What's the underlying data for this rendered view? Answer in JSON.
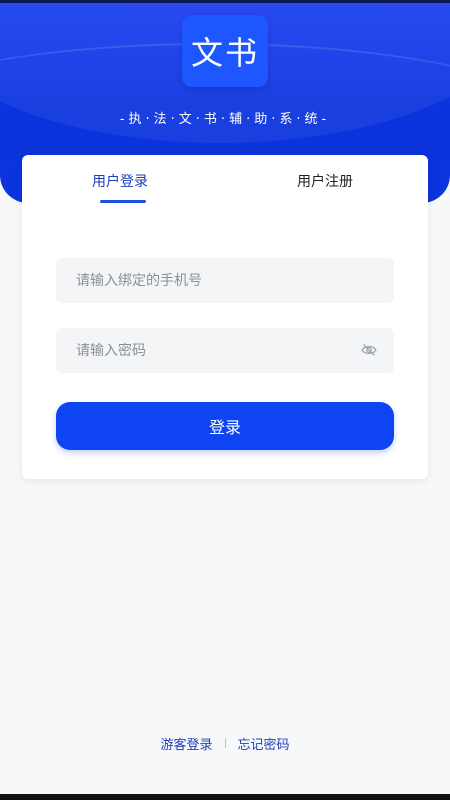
{
  "app": {
    "logo_text": "文书",
    "subtitle": "-执·法·文·书·辅·助·系·统-"
  },
  "tabs": {
    "login": "用户登录",
    "register": "用户注册"
  },
  "form": {
    "phone_placeholder": "请输入绑定的手机号",
    "password_placeholder": "请输入密码",
    "login_button": "登录"
  },
  "footer": {
    "guest_login": "游客登录",
    "forgot_password": "忘记密码"
  },
  "colors": {
    "primary": "#0f44f2",
    "header": "#0b33dd",
    "active_tab_text": "#1c3fb8"
  },
  "icons": {
    "password_toggle": "eye-off-icon"
  }
}
